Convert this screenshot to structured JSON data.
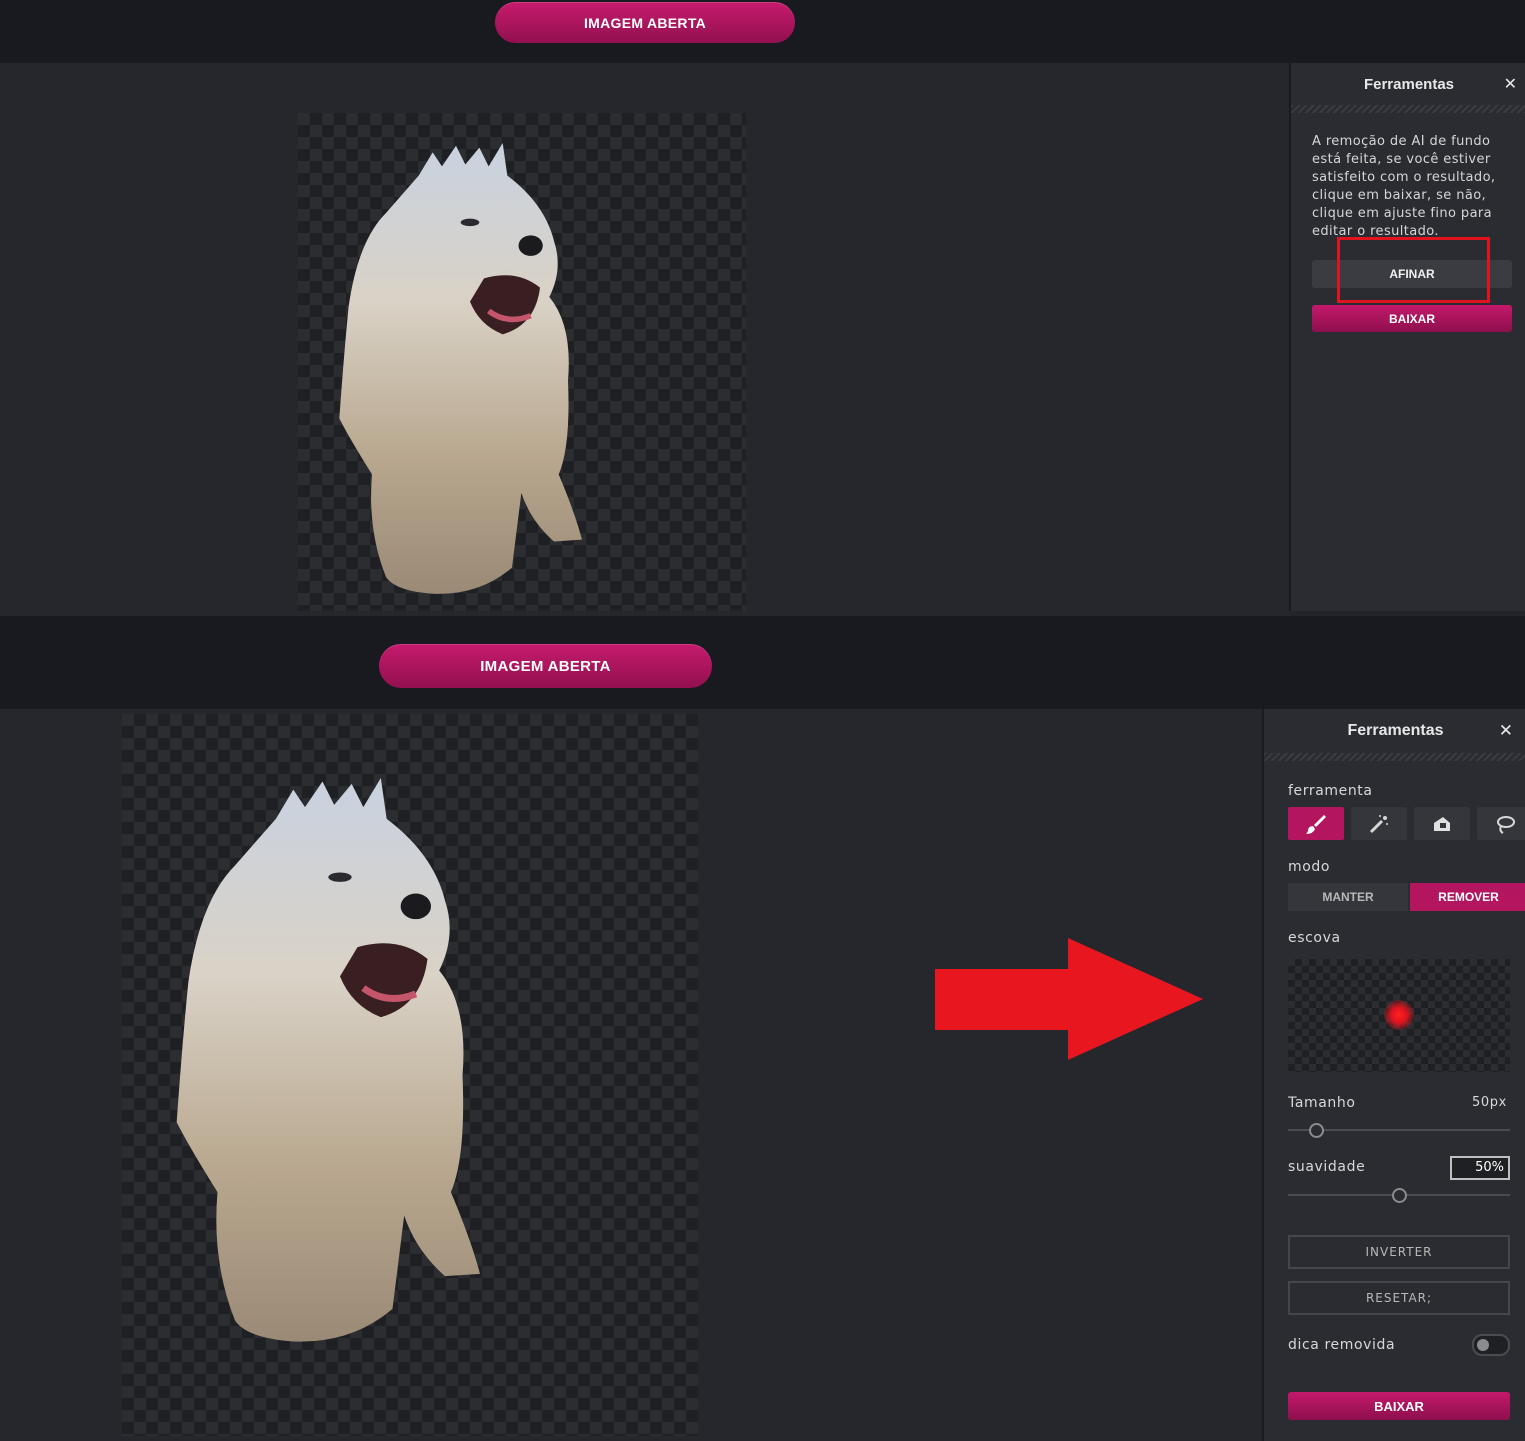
{
  "top": {
    "open_button": "IMAGEM ABERTA",
    "panel": {
      "title": "Ferramentas",
      "close": "✕",
      "info": "A remoção de AI de fundo está feita, se você estiver satisfeito com o resultado, clique em baixar, se não, clique em ajuste fino para editar o resultado.",
      "refine_button": "AFINAR",
      "download_button": "BAIXAR"
    }
  },
  "bottom": {
    "open_button": "IMAGEM ABERTA",
    "panel": {
      "title": "Ferramentas",
      "close": "✕",
      "tool_label": "ferramenta",
      "tools": [
        "brush-icon",
        "magic-wand-icon",
        "eraser-icon",
        "lasso-icon"
      ],
      "mode_label": "modo",
      "mode_keep": "MANTER",
      "mode_remove": "REMOVER",
      "brush_label": "escova",
      "size_label": "Tamanho",
      "size_value": "50px",
      "size_fraction": 0.13,
      "smooth_label": "suavidade",
      "smooth_value": "50%",
      "smooth_fraction": 0.5,
      "invert_button": "INVERTER",
      "reset_button": "RESETAR;",
      "hint_label": "dica removida",
      "hint_toggle": false,
      "download_button": "BAIXAR"
    }
  },
  "colors": {
    "accent": "#b3155f",
    "annotation_red": "#e0141e"
  }
}
